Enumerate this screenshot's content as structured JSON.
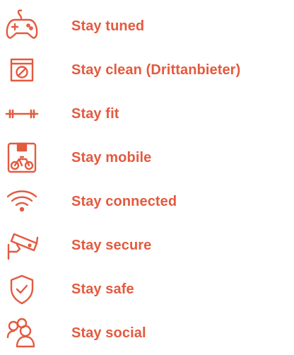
{
  "colors": {
    "accent": "#E35A3F",
    "background": "#FFFFFF"
  },
  "features": [
    {
      "icon": "gamepad-icon",
      "label": "Stay tuned"
    },
    {
      "icon": "washing-machine-icon",
      "label": "Stay clean (Drittanbieter)"
    },
    {
      "icon": "dumbbell-icon",
      "label": "Stay fit"
    },
    {
      "icon": "bike-storage-icon",
      "label": "Stay mobile"
    },
    {
      "icon": "wifi-icon",
      "label": "Stay connected"
    },
    {
      "icon": "security-camera-icon",
      "label": "Stay secure"
    },
    {
      "icon": "shield-check-icon",
      "label": "Stay safe"
    },
    {
      "icon": "people-group-icon",
      "label": "Stay social"
    }
  ]
}
